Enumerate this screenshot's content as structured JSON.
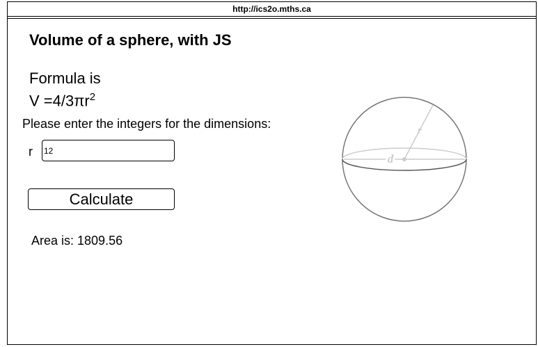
{
  "browser": {
    "url": "http://ics2o.mths.ca"
  },
  "page": {
    "title": "Volume of a sphere, with JS",
    "formula_heading": "Formula is",
    "formula_text": "V =4/3πr",
    "formula_exponent": "2",
    "prompt": "Please enter the integers for the dimensions:"
  },
  "form": {
    "r_label": "r",
    "r_value": "12",
    "calculate_label": "Calculate"
  },
  "result": {
    "text": "Area is: 1809.56"
  },
  "diagram": {
    "radius_label": "r",
    "diameter_label": "d"
  }
}
